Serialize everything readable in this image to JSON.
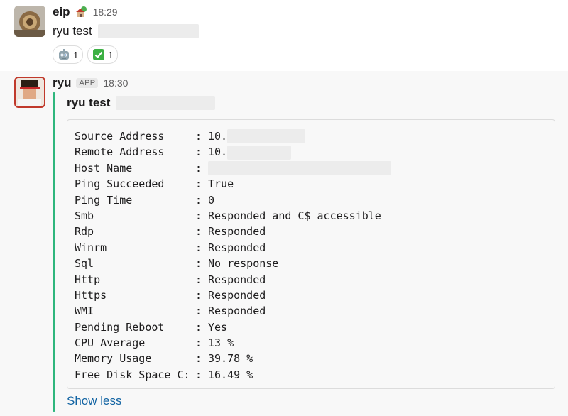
{
  "messages": [
    {
      "user": "eip",
      "time": "18:29",
      "status_emoji": "house-tree-icon",
      "text": "ryu test",
      "reactions": [
        {
          "icon": "robot-icon",
          "count": "1"
        },
        {
          "icon": "check-mark-icon",
          "count": "1"
        }
      ]
    },
    {
      "user": "ryu",
      "badge": "APP",
      "time": "18:30",
      "attachment": {
        "title": "ryu test",
        "bar_color": "#2eb67d",
        "rows": [
          {
            "key": "Source Address",
            "sep": ":",
            "value": "10."
          },
          {
            "key": "Remote Address",
            "sep": ":",
            "value": "10."
          },
          {
            "key": "Host Name",
            "sep": ":",
            "value": ""
          },
          {
            "key": "Ping Succeeded",
            "sep": ":",
            "value": "True"
          },
          {
            "key": "Ping Time",
            "sep": ":",
            "value": "0"
          },
          {
            "key": "Smb",
            "sep": ":",
            "value": "Responded and C$ accessible"
          },
          {
            "key": "Rdp",
            "sep": ":",
            "value": "Responded"
          },
          {
            "key": "Winrm",
            "sep": ":",
            "value": "Responded"
          },
          {
            "key": "Sql",
            "sep": ":",
            "value": "No response"
          },
          {
            "key": "Http",
            "sep": ":",
            "value": "Responded"
          },
          {
            "key": "Https",
            "sep": ":",
            "value": "Responded"
          },
          {
            "key": "WMI",
            "sep": ":",
            "value": "Responded"
          },
          {
            "key": "Pending Reboot",
            "sep": ":",
            "value": "Yes"
          },
          {
            "key": "CPU Average",
            "sep": ":",
            "value": "13 %"
          },
          {
            "key": "Memory Usage",
            "sep": ":",
            "value": "39.78 %"
          },
          {
            "key": "Free Disk Space C:",
            "sep": ":",
            "value": "16.49 %"
          }
        ],
        "show_less": "Show less"
      }
    }
  ]
}
